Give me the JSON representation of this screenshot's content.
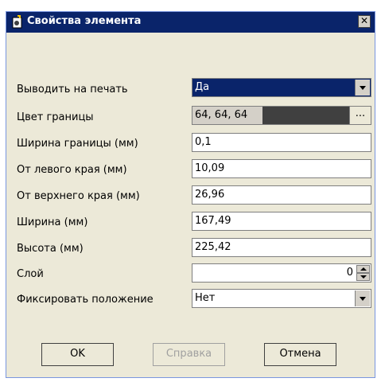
{
  "window": {
    "title": "Свойства элемента",
    "close_label": "✕"
  },
  "fields": {
    "print": {
      "label": "Выводить на печать",
      "value": "Да"
    },
    "border_color": {
      "label": "Цвет границы",
      "value": "64, 64, 64",
      "swatch": "#404040",
      "button": "..."
    },
    "border_width": {
      "label": "Ширина границы (мм)",
      "value": "0,1"
    },
    "left_offset": {
      "label": "От левого края (мм)",
      "value": "10,09"
    },
    "top_offset": {
      "label": "От верхнего края (мм)",
      "value": "26,96"
    },
    "width": {
      "label": "Ширина (мм)",
      "value": "167,49"
    },
    "height": {
      "label": "Высота (мм)",
      "value": "225,42"
    },
    "layer": {
      "label": "Слой",
      "value": "0"
    },
    "lock_position": {
      "label": "Фиксировать положение",
      "value": "Нет"
    }
  },
  "buttons": {
    "ok": "OK",
    "help": "Справка",
    "cancel": "Отмена"
  }
}
